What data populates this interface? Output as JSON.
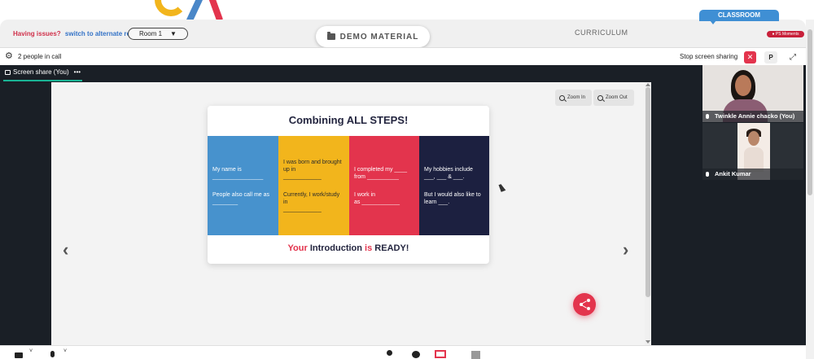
{
  "header": {
    "issues_text": "Having issues?",
    "alt_room_link": "switch to alternate room",
    "room_select": "Room 1",
    "demo_material": "DEMO MATERIAL",
    "curriculum": "CURRICULUM",
    "classroom": "CLASSROOM",
    "moments": "PS Moments"
  },
  "callbar": {
    "people_count": "2 people in call",
    "stop_sharing": "Stop screen sharing",
    "stop_symbol": "✕",
    "p_label": "P",
    "expand_symbol": "⤢"
  },
  "share": {
    "tab_label": "Screen share (You)",
    "tab_more": "•••",
    "zoom_in": "Zoom In",
    "zoom_out": "Zoom Out",
    "prev_arrow": "‹",
    "next_arrow": "›"
  },
  "slide": {
    "title": "Combining ALL STEPS!",
    "columns": [
      {
        "line1": "My name is",
        "blank1": "________________",
        "line2": "People also call me as",
        "blank2": "________"
      },
      {
        "line1": "I was born and brought up in",
        "blank1": "____________",
        "line2": "Currently, I work/study in",
        "blank2": "____________"
      },
      {
        "line1": "I completed my ____ from",
        "blank1": "__________",
        "line2": "I work in",
        "blank2": "as ____________"
      },
      {
        "line1": "My hobbies include ___, ___ & ___.",
        "blank1": "",
        "line2": "But I would also like to learn ___.",
        "blank2": ""
      }
    ],
    "footer_your": "Your",
    "footer_intro": "Introduction",
    "footer_is": "is",
    "footer_ready": "READY!"
  },
  "participants": [
    {
      "name": "Twinkle Annie chacko (You)"
    },
    {
      "name": "Ankit Kumar"
    }
  ],
  "bottombar": {
    "chevron": "˅"
  },
  "colors": {
    "accent_red": "#e3344d",
    "accent_blue": "#3f8fd4",
    "slide_blue": "#4792cd",
    "slide_yellow": "#f2b51c",
    "slide_navy": "#1c2040",
    "dark_bg": "#1a1f26"
  },
  "icons": [
    "gear-icon",
    "folder-icon",
    "monitor-icon",
    "magnifier-icon",
    "share-icon",
    "camera-icon",
    "mic-icon",
    "person-icon",
    "chat-icon",
    "screen-share-icon",
    "square-icon"
  ]
}
